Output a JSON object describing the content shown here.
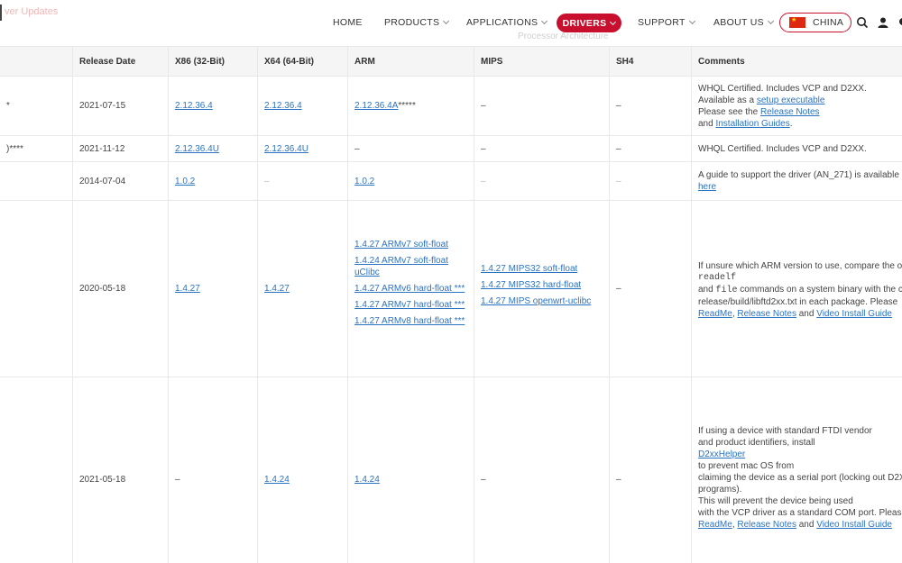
{
  "header": {
    "ghost_text": "ver Updates",
    "ghost_subtitle": "Processor Architecture",
    "nav": [
      "HOME",
      "PRODUCTS",
      "APPLICATIONS",
      "DRIVERS",
      "SUPPORT",
      "ABOUT US"
    ],
    "region_label": "CHINA"
  },
  "table": {
    "headers": [
      "",
      "Release Date",
      "X86 (32-Bit)",
      "X64 (64-Bit)",
      "ARM",
      "MIPS",
      "SH4",
      "Comments"
    ],
    "rows": [
      {
        "os": "*",
        "date": "2021-07-15",
        "x86": "2.12.36.4",
        "x64": "2.12.36.4",
        "arm": "2.12.36.4A",
        "arm_suffix": "*****",
        "mips": "–",
        "sh4": "–",
        "comments": {
          "line1": "WHQL Certified. Includes VCP and D2XX.",
          "line2_pre": "Available as a ",
          "line2_link": "setup executable",
          "line3_pre": "Please see the ",
          "line3_link": "Release Notes",
          "line4_pre": "and ",
          "line4_link": "Installation Guides",
          "line4_post": "."
        }
      },
      {
        "os": ")****",
        "date": "2021-11-12",
        "x86": "2.12.36.4U",
        "x64": "2.12.36.4U",
        "arm": "–",
        "mips": "–",
        "sh4": "–",
        "comments": "WHQL Certified. Includes VCP and D2XX."
      },
      {
        "os": "",
        "date": "2014-07-04",
        "x86": "1.0.2",
        "x64": "–",
        "arm": "1.0.2",
        "mips": "–",
        "sh4": "–",
        "comments": {
          "line1": "A guide to support the driver (AN_271) is available",
          "line2_link": "here"
        }
      },
      {
        "os": "",
        "date": "2020-05-18",
        "x86": "1.4.27",
        "x64": "1.4.27",
        "arm_links": [
          "1.4.27 ARMv7 soft-float",
          "1.4.24 ARMv7 soft-float uClibc",
          "1.4.27 ARMv6 hard-float ***",
          "1.4.27 ARMv7 hard-float ***",
          "1.4.27 ARMv8 hard-float ***"
        ],
        "mips_links": [
          "1.4.27 MIPS32 soft-float",
          "1.4.27 MIPS32 hard-float",
          "1.4.27 MIPS openwrt-uclibc"
        ],
        "sh4": "–",
        "comments": {
          "line1": "If unsure which ARM version to use, compare the ou",
          "line2_code": "readelf",
          "line3_pre": "and ",
          "line3_code": "file",
          "line3_post": " commands on a system binary with the c",
          "line4": "release/build/libftd2xx.txt in each package. Please",
          "link1": "ReadMe",
          "sep1": ", ",
          "link2": "Release Notes",
          "and": " and ",
          "link3": "Video Install Guide"
        }
      },
      {
        "os": "",
        "date": "2021-05-18",
        "x86": "–",
        "x64": "1.4.24",
        "arm": "1.4.24",
        "mips": "–",
        "sh4": "–",
        "comments": {
          "line1": "If using a device with standard FTDI vendor",
          "line2": "and product identifiers, install",
          "line3_link": "D2xxHelper",
          "line4": "to prevent mac OS from",
          "line5": "claiming the device as a serial port (locking out D2X",
          "line6": "programs).",
          "line7": "This will prevent the device being used",
          "line8": "with the VCP driver as a standard COM port. Please",
          "link1": "ReadMe",
          "sep1": ", ",
          "link2": "Release Notes",
          "and": " and ",
          "link3": "Video Install Guide"
        }
      }
    ]
  },
  "colors": {
    "brand_red": "#c8102e",
    "link_blue": "#2a73c1"
  }
}
